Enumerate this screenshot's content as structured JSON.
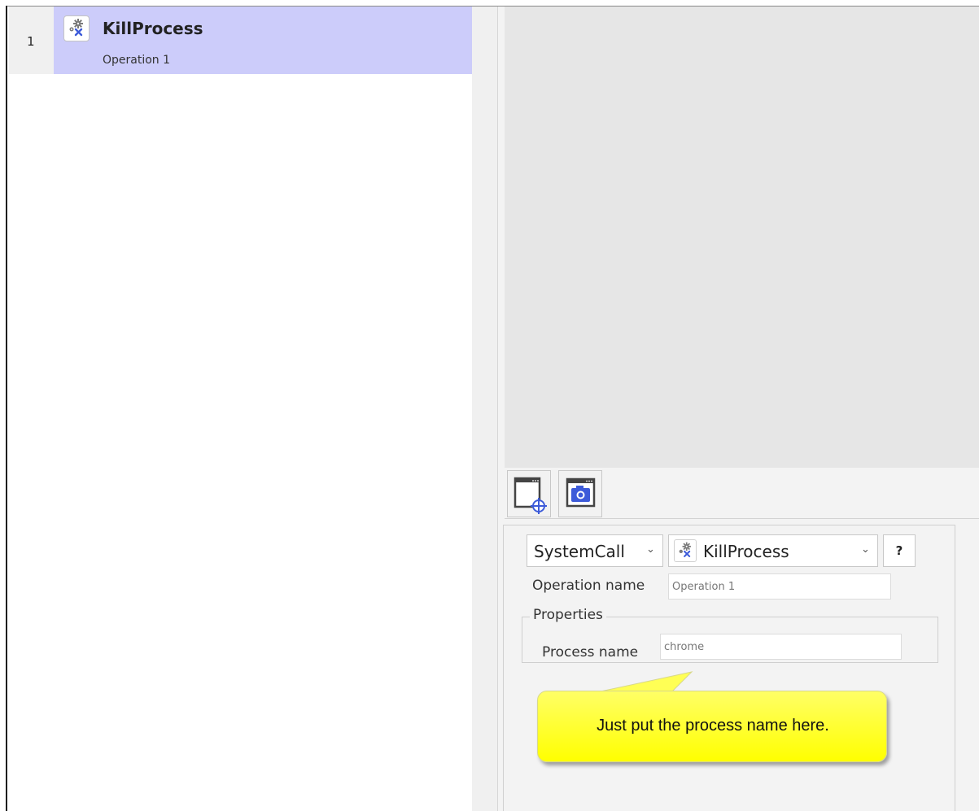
{
  "operations": [
    {
      "index": "1",
      "title": "KillProcess",
      "subtitle": "Operation 1",
      "icon": "gear-x-icon"
    }
  ],
  "toolbar": {
    "buttons": [
      {
        "icon": "window-target-icon"
      },
      {
        "icon": "window-camera-icon"
      }
    ]
  },
  "properties": {
    "category_select": "SystemCall",
    "action_select": "KillProcess",
    "help_label": "?",
    "operation_name_label": "Operation name",
    "operation_name_value": "Operation 1",
    "group_label": "Properties",
    "process_name_label": "Process name",
    "process_name_value": "chrome"
  },
  "callout": {
    "text": "Just put the process name here."
  },
  "colors": {
    "selected_row": "#ccccfa",
    "preview_bg": "#e6e6e6",
    "callout_fill": "#ffff00",
    "icon_accent": "#3d5bd9"
  }
}
